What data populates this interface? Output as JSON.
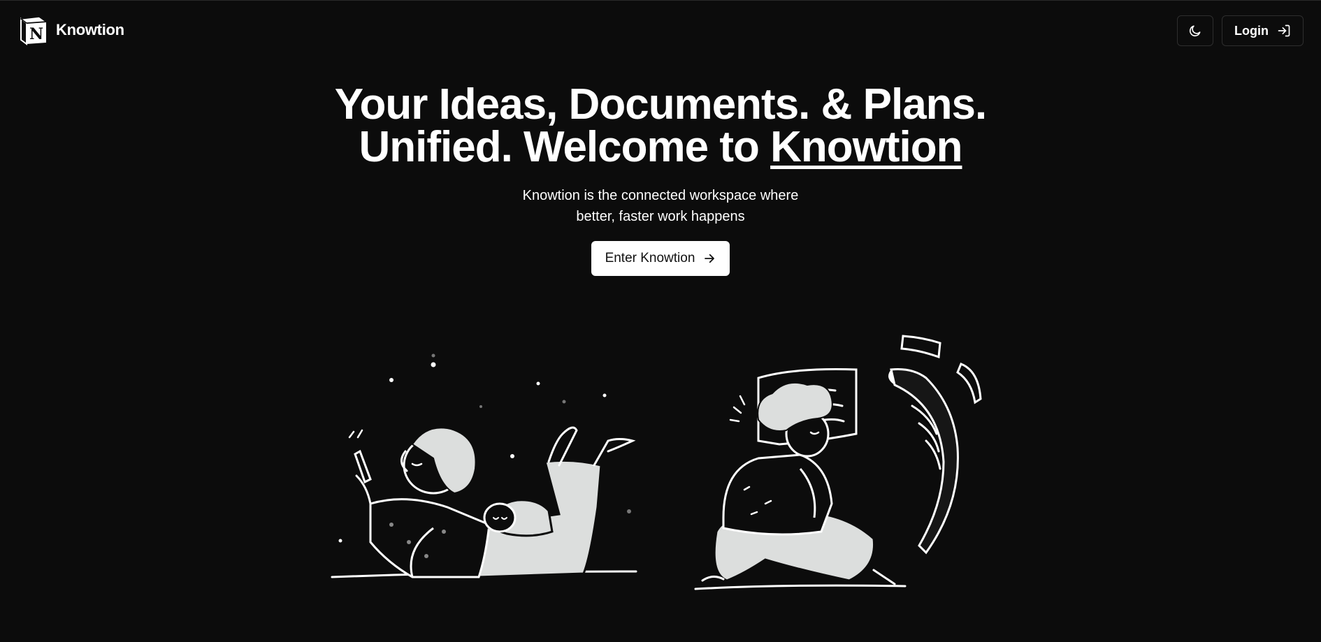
{
  "header": {
    "brand_name": "Knowtion",
    "logo_letter": "N",
    "theme_toggle_icon": "moon-icon",
    "login_label": "Login",
    "login_icon": "login-arrow-icon"
  },
  "hero": {
    "title_line1": "Your Ideas, Documents. & Plans.",
    "title_line2_prefix": "Unified. Welcome to",
    "title_line2_brand": "Knowtion",
    "subtitle_line1": "Knowtion is the connected workspace where",
    "subtitle_line2": "better, faster work happens",
    "cta_label": "Enter Knowtion",
    "cta_icon": "arrow-right-icon"
  },
  "illustrations": {
    "left": "reading-person-with-dog-illustration",
    "right": "thinking-person-with-documents-illustration"
  },
  "colors": {
    "background": "#0c0c0c",
    "text": "#ffffff",
    "button_bg": "#ffffff",
    "button_text": "#111111",
    "border": "#2e2e2e",
    "illustration_fill": "#dcdedd"
  }
}
